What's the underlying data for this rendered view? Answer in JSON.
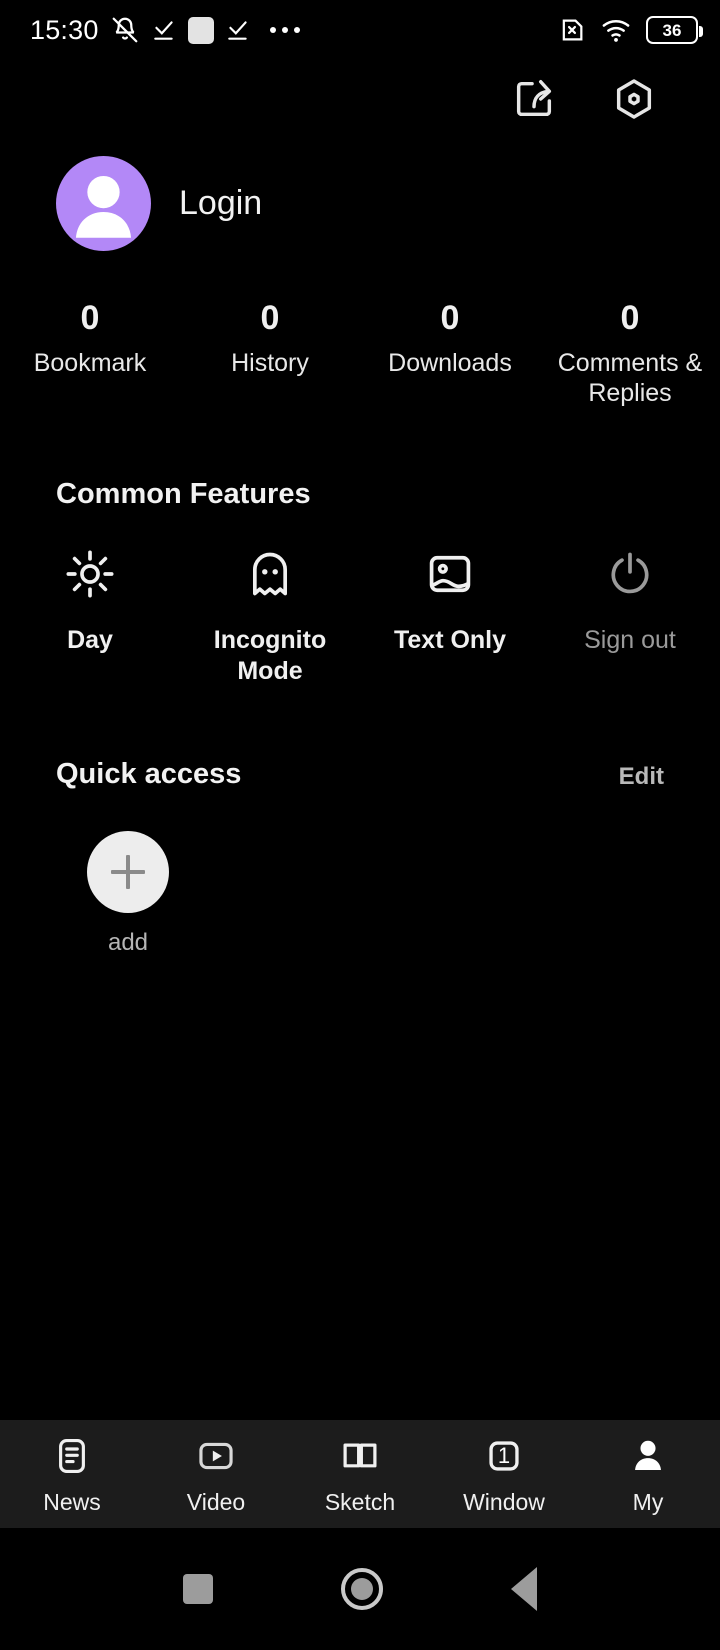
{
  "status_bar": {
    "time": "15:30",
    "icons": [
      "bell-muted-icon",
      "check-underline-icon",
      "white-square-icon",
      "check-underline-icon",
      "more-dots-icon"
    ],
    "right_icons": [
      "sim-error-icon",
      "wifi-icon"
    ],
    "battery_level": "36"
  },
  "top_bar": {
    "actions": [
      {
        "name": "share-icon",
        "label": "Share"
      },
      {
        "name": "settings-hexagon-icon",
        "label": "Settings"
      }
    ]
  },
  "profile": {
    "avatar_icon": "person-avatar-icon",
    "avatar_color": "#b388f7",
    "login_label": "Login"
  },
  "stats": [
    {
      "value": "0",
      "label": "Bookmark"
    },
    {
      "value": "0",
      "label": "History"
    },
    {
      "value": "0",
      "label": "Downloads"
    },
    {
      "value": "0",
      "label": "Comments & Replies"
    }
  ],
  "common_features": {
    "title": "Common Features",
    "items": [
      {
        "label": "Day",
        "icon": "sun-icon",
        "disabled": false
      },
      {
        "label": "Incognito Mode",
        "icon": "ghost-icon",
        "disabled": false
      },
      {
        "label": "Text Only",
        "icon": "image-icon",
        "disabled": false
      },
      {
        "label": "Sign out",
        "icon": "power-icon",
        "disabled": true
      }
    ]
  },
  "quick_access": {
    "title": "Quick access",
    "edit_label": "Edit",
    "add_label": "add",
    "add_icon": "plus-icon"
  },
  "tab_bar": {
    "items": [
      {
        "label": "News",
        "icon": "news-document-icon",
        "active": false
      },
      {
        "label": "Video",
        "icon": "video-play-icon",
        "active": false
      },
      {
        "label": "Sketch",
        "icon": "open-book-icon",
        "active": false
      },
      {
        "label": "Window",
        "icon": "window-count-icon",
        "active": false,
        "count": "1"
      },
      {
        "label": "My",
        "icon": "person-filled-icon",
        "active": true
      }
    ]
  },
  "system_nav": {
    "buttons": [
      "recents-square-button",
      "home-circle-button",
      "back-triangle-button"
    ]
  }
}
